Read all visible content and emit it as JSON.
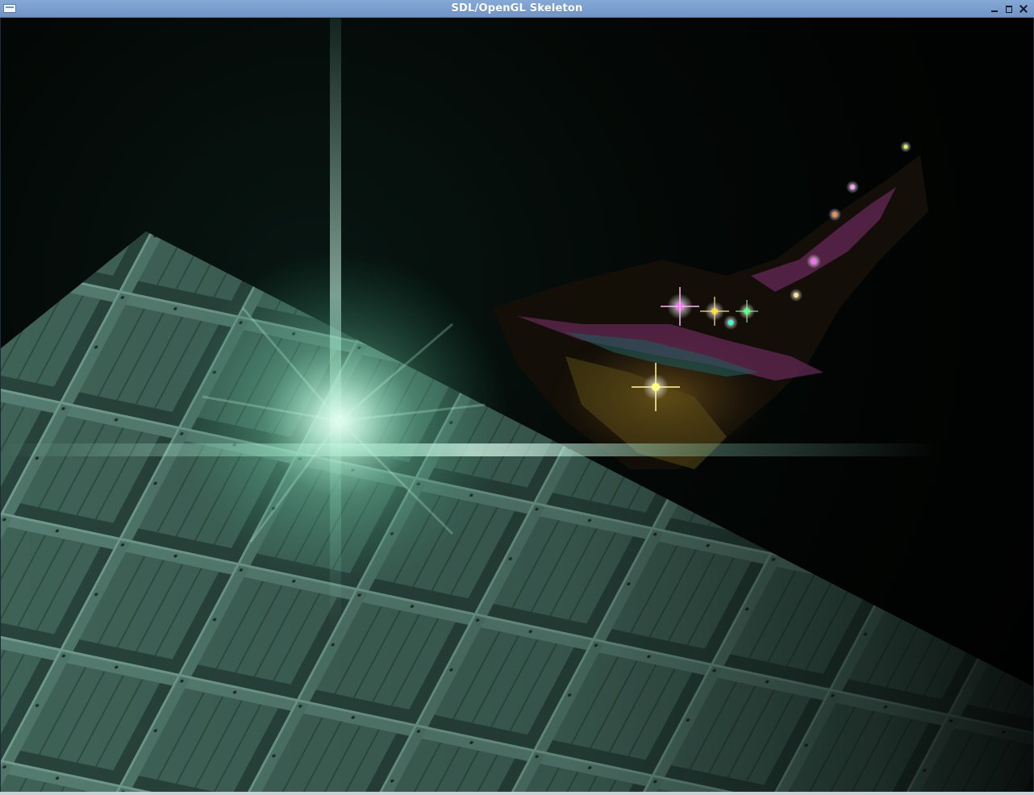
{
  "window": {
    "title": "SDL/OpenGL Skeleton",
    "controls": {
      "menu_icon": "window-menu-icon",
      "minimize_icon": "minimize-icon",
      "maximize_icon": "maximize-icon",
      "close_icon": "close-icon"
    }
  },
  "scene": {
    "description_colors": {
      "crate_wall": "#5f8a7a",
      "flare": "#cfffee",
      "sparkle_colors": [
        "#ff66ff",
        "#ffd21a",
        "#33ff55",
        "#33ffd9",
        "#ff8a3a",
        "#ffff66"
      ]
    }
  }
}
